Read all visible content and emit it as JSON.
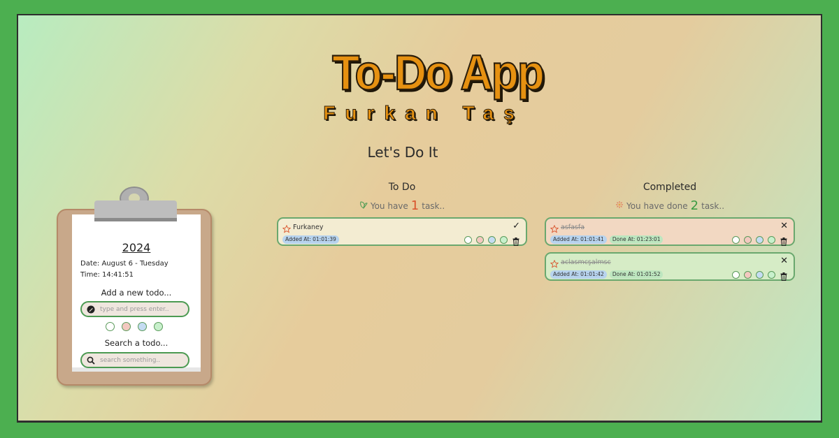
{
  "header": {
    "title": "To-Do App",
    "subtitle": "Furkan Taş",
    "heading": "Let's Do It"
  },
  "clipboard": {
    "year": "2024",
    "date": "Date: August 6 - Tuesday",
    "time": "Time: 14:41:51",
    "add_label": "Add a new todo...",
    "add_placeholder": "type and press enter..",
    "search_label": "Search a todo...",
    "search_placeholder": "search something..",
    "colors": [
      "#ffffff",
      "#f3c8c0",
      "#c5dcf2",
      "#c8f0cc"
    ]
  },
  "todo": {
    "title": "To Do",
    "count_prefix": "You have",
    "count": "1",
    "count_suffix": "task..",
    "count_color": "#d9532c",
    "items": [
      {
        "name": "Furkaney",
        "added": "Added At: 01:01:39",
        "bg": "#f3ecd2"
      }
    ]
  },
  "completed": {
    "title": "Completed",
    "count_prefix": "You have done",
    "count": "2",
    "count_suffix": "task..",
    "count_color": "#3a9a42",
    "items": [
      {
        "name": "asfasfa",
        "added": "Added At: 01:01:41",
        "done": "Done At: 01:23:01",
        "bg": "#f2d8c2"
      },
      {
        "name": "aclasmcşalmsc",
        "added": "Added At: 01:01:42",
        "done": "Done At: 01:01:52",
        "bg": "#d6ecc6"
      }
    ]
  }
}
